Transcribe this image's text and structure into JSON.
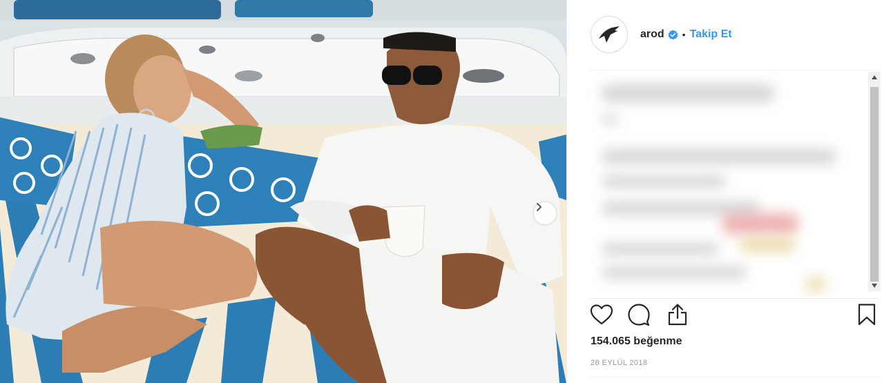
{
  "post": {
    "username": "arod",
    "separator": "•",
    "follow_label": "Takip Et",
    "likes_count": "154.065",
    "likes_word": "beğenme",
    "date": "28 EYLÜL 2018"
  },
  "icons": {
    "verified": "verified-badge-icon",
    "like": "heart-icon",
    "comment": "comment-icon",
    "share": "share-icon",
    "save": "bookmark-icon",
    "next": "chevron-right-icon",
    "avatar": "athlete-logo-icon"
  },
  "colors": {
    "link_blue": "#3897f0",
    "verified_blue": "#3897f0",
    "text": "#262626",
    "muted": "#999999"
  }
}
